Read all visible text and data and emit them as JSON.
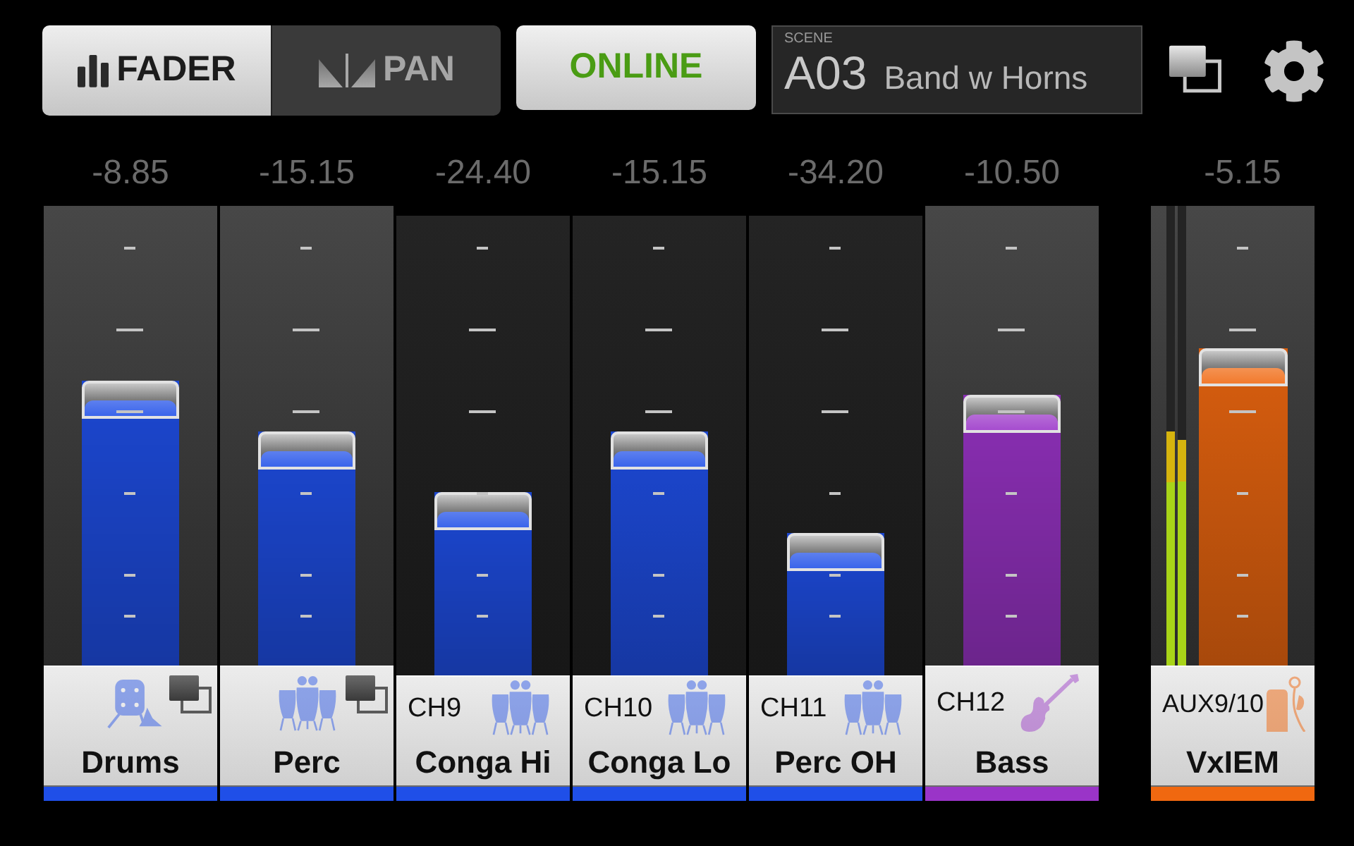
{
  "mode_tabs": [
    {
      "label": "FADER",
      "selected": true
    },
    {
      "label": "PAN",
      "selected": false
    }
  ],
  "online_button": {
    "label": "ONLINE"
  },
  "scene": {
    "caption": "SCENE",
    "number": "A03",
    "name": "Band w Horns"
  },
  "channels": [
    {
      "value": "-8.85",
      "name": "Drums",
      "group": true,
      "dimmed": false,
      "level": 0.62,
      "color": "#1f4fe8"
    },
    {
      "value": "-15.15",
      "name": "Perc",
      "group": true,
      "dimmed": false,
      "level": 0.51,
      "color": "#1f4fe8"
    },
    {
      "value": "-24.40",
      "channel": "CH9",
      "name": "Conga Hi",
      "group": false,
      "dimmed": true,
      "level": 0.4,
      "color": "#1f4fe8"
    },
    {
      "value": "-15.15",
      "channel": "CH10",
      "name": "Conga Lo",
      "group": false,
      "dimmed": true,
      "level": 0.53,
      "color": "#1f4fe8"
    },
    {
      "value": "-34.20",
      "channel": "CH11",
      "name": "Perc OH",
      "group": false,
      "dimmed": true,
      "level": 0.31,
      "color": "#1f4fe8"
    },
    {
      "value": "-10.50",
      "channel": "CH12",
      "name": "Bass",
      "group": false,
      "dimmed": false,
      "level": 0.59,
      "color": "#9a34c8"
    }
  ],
  "aux": {
    "value": "-5.15",
    "channel": "AUX9/10",
    "name": "VxIEM",
    "level": 0.69,
    "color": "#f06810",
    "meters": [
      {
        "level": 0.51
      },
      {
        "level": 0.49
      }
    ]
  }
}
